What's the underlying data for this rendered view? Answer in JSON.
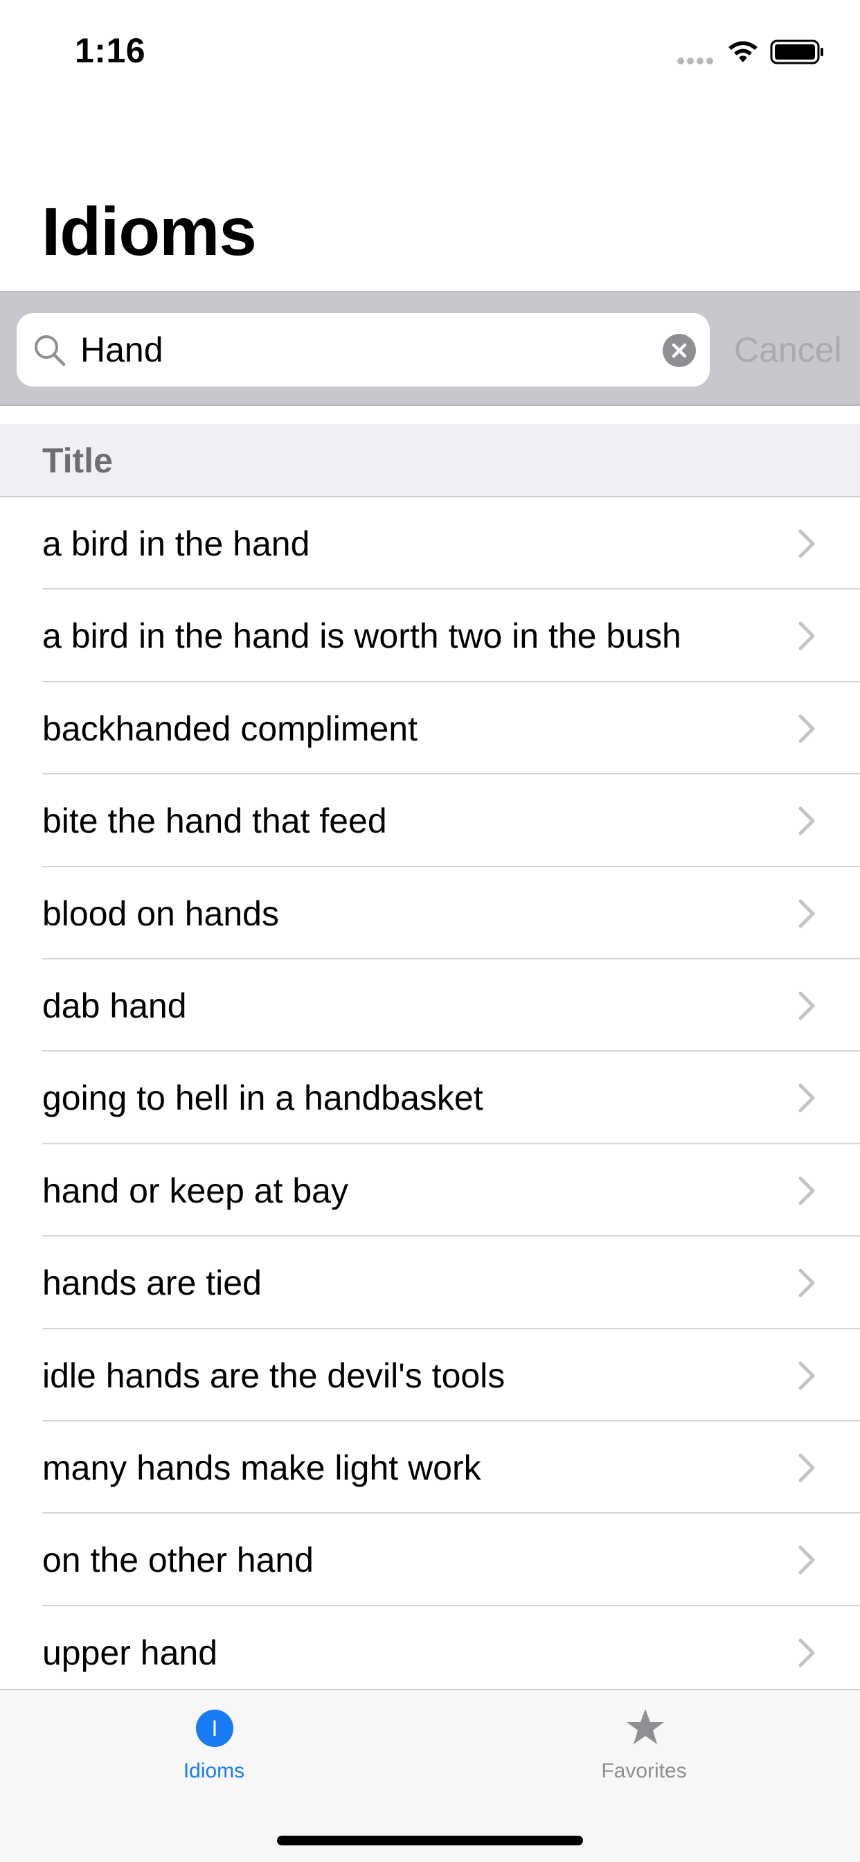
{
  "status_bar": {
    "time": "1:16"
  },
  "nav": {
    "title": "Idioms"
  },
  "search": {
    "value": "Hand",
    "cancel_label": "Cancel"
  },
  "section": {
    "title": "Title"
  },
  "list": {
    "items": [
      {
        "label": "a bird in the hand"
      },
      {
        "label": "a bird in the hand is worth two in the bush"
      },
      {
        "label": "backhanded compliment"
      },
      {
        "label": "bite the hand that feed"
      },
      {
        "label": "blood on hands"
      },
      {
        "label": "dab hand"
      },
      {
        "label": "going to hell in a handbasket"
      },
      {
        "label": "hand or keep at bay"
      },
      {
        "label": "hands are tied"
      },
      {
        "label": "idle hands are the devil's tools"
      },
      {
        "label": "many hands make light work"
      },
      {
        "label": "on the other hand"
      },
      {
        "label": "upper hand"
      }
    ]
  },
  "tab_bar": {
    "tabs": [
      {
        "label": "Idioms",
        "icon": "idioms-icon",
        "icon_glyph": "I",
        "selected": true
      },
      {
        "label": "Favorites",
        "icon": "star-icon",
        "selected": false
      }
    ]
  },
  "colors": {
    "accent": "#1a7cf4",
    "inactive": "#8e8e93",
    "search_background": "#c8c8cc",
    "section_background": "#efeff4"
  }
}
